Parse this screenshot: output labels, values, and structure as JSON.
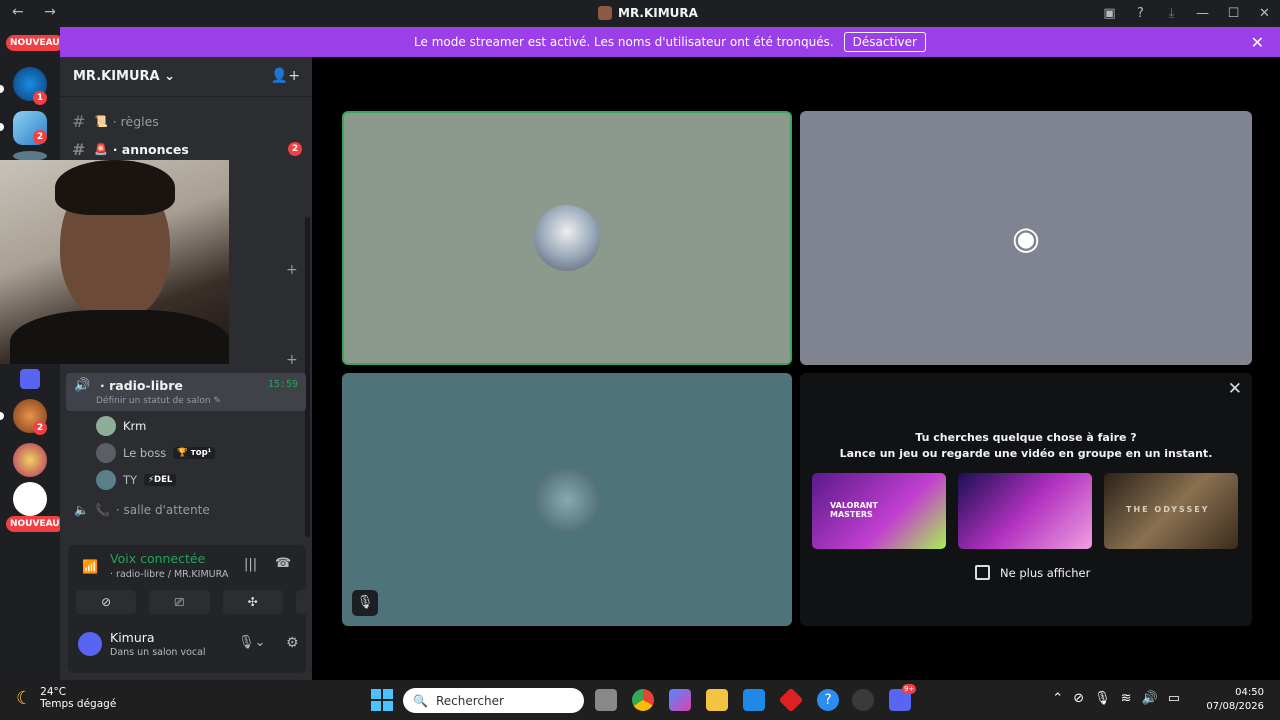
{
  "window": {
    "nav": "← →",
    "title": "MR.KIMURA",
    "icons": [
      "inbox-icon",
      "help-icon",
      "download-icon",
      "minimize-icon",
      "maximize-icon",
      "close-icon"
    ]
  },
  "banner": {
    "text": "Le mode streamer est activé. Les noms d'utilisateur ont été tronqués.",
    "button": "Désactiver",
    "close": "✕"
  },
  "guilds": {
    "nouveau_top": "NOUVEAU",
    "nouveau_bottom": "NOUVEAU",
    "counts": [
      "1",
      "2",
      "2"
    ]
  },
  "sidebar": {
    "server_name": "MR.KIMURA",
    "channels": [
      {
        "label": "· règles",
        "emoji": "📜",
        "unread": false,
        "count": ""
      },
      {
        "label": "· annonces",
        "emoji": "🚨",
        "unread": true,
        "count": "2"
      }
    ],
    "voice_channel": {
      "name": "· radio-libre",
      "time": "15:59",
      "status": "Définir un statut de salon ✎"
    },
    "voice_users": [
      {
        "name": "Krm",
        "tag": ""
      },
      {
        "name": "Le boss",
        "tag": "🏆 тор¹"
      },
      {
        "name": "TY",
        "tag": "⚡DEL"
      }
    ],
    "waiting_channel": "· salle d'attente"
  },
  "voice_panel": {
    "title": "Voix connectée",
    "subtitle": "· radio-libre / MR.KIMURA",
    "buttons": [
      "camera-off-icon",
      "screen-share-icon",
      "activities-icon",
      "soundboard-icon"
    ]
  },
  "user": {
    "name": "Kimura",
    "status": "Dans un salon vocal"
  },
  "activity": {
    "line1": "Tu cherches quelque chose à faire ?",
    "line2": "Lance un jeu ou regarde une vidéo en groupe en un instant.",
    "cards": [
      "VALORANT MASTERS",
      "",
      "THE ODYSSEY"
    ],
    "checkbox": "Ne plus afficher"
  },
  "taskbar": {
    "temp": "24°C",
    "weather": "Temps dégagé",
    "search_placeholder": "Rechercher",
    "time": "04:50",
    "date": "07/08/2026",
    "discord_badge": "9+"
  },
  "colors": {
    "accent": "#9b3fe8",
    "green": "#23a55a",
    "red": "#f23f43",
    "blurple": "#5865f2"
  }
}
